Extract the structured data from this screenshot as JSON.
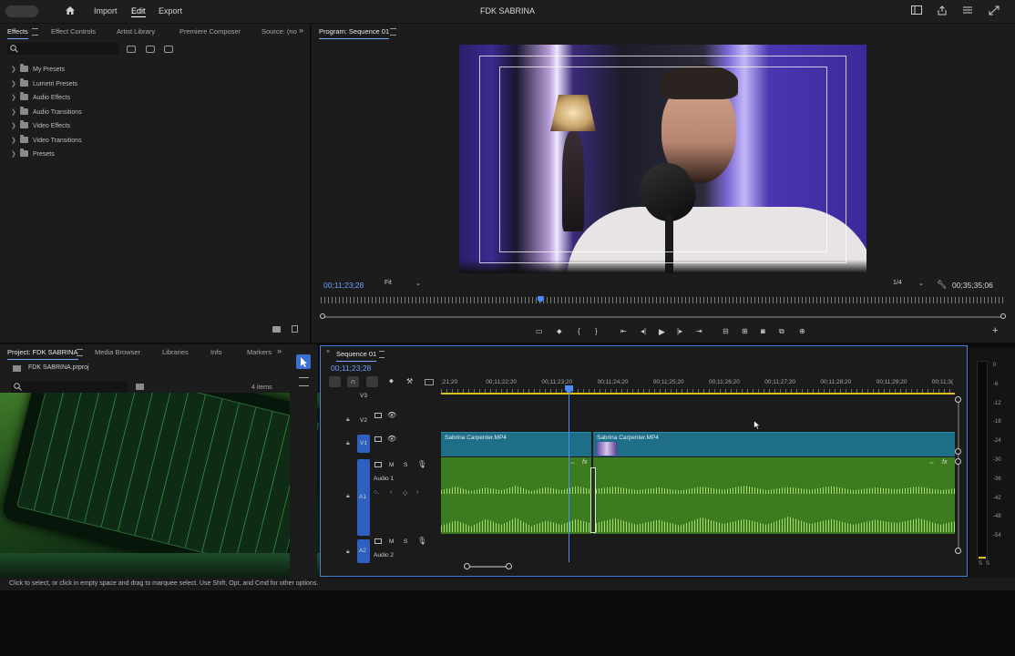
{
  "topbar": {
    "menus": [
      "Import",
      "Edit",
      "Export"
    ],
    "active_menu": "Edit",
    "title": "FDK SABRINA"
  },
  "effects_panel": {
    "tabs": [
      "Effects",
      "Effect Controls",
      "Artist Library",
      "Premiere Composer",
      "Source: (no"
    ],
    "active_tab": "Effects",
    "search_placeholder": "",
    "items": [
      "My Presets",
      "Lumetri Presets",
      "Audio Effects",
      "Audio Transitions",
      "Video Effects",
      "Video Transitions",
      "Presets"
    ]
  },
  "program_monitor": {
    "tab": "Program: Sequence 01",
    "timecode_current": "00;11;23;28",
    "fit": "Fit",
    "resolution": "1/4",
    "timecode_duration": "00;35;35;06",
    "playhead_fraction": 0.32
  },
  "project_panel": {
    "tabs": [
      "Project: FDK SABRINA",
      "Media Browser",
      "Libraries",
      "Info",
      "Markers"
    ],
    "file": "FDK SABRINA.prproj",
    "items_count": "4 items"
  },
  "timeline": {
    "tab": "Sequence 01",
    "timecode": "00;11;23;28",
    "ruler_labels": [
      ";21;20",
      "00;11;22;20",
      "00;11;23;20",
      "00;11;24;20",
      "00;11;25;20",
      "00;11;26;20",
      "00;11;27;20",
      "00;11;28;20",
      "00;11;29;20",
      "00;11;3("
    ],
    "tracks": {
      "v3": "V3",
      "v2": "V2",
      "v1": "V1",
      "a1": "A1",
      "a2": "A2",
      "audio1_name": "Audio 1",
      "audio2_name": "Audio 2",
      "m": "M",
      "s": "S"
    },
    "clips": [
      "Sabrina Carpenter.MP4",
      "Sabrina Carpenter.MP4"
    ],
    "meter_scale": [
      "0",
      "-6",
      "-12",
      "-18",
      "-24",
      "-30",
      "-36",
      "-42",
      "-48",
      "-54"
    ],
    "meter_bottom": [
      "S",
      "S"
    ]
  },
  "status_bar": "Click to select, or click in empty space and drag to marquee select. Use Shift, Opt, and Cmd for other options."
}
